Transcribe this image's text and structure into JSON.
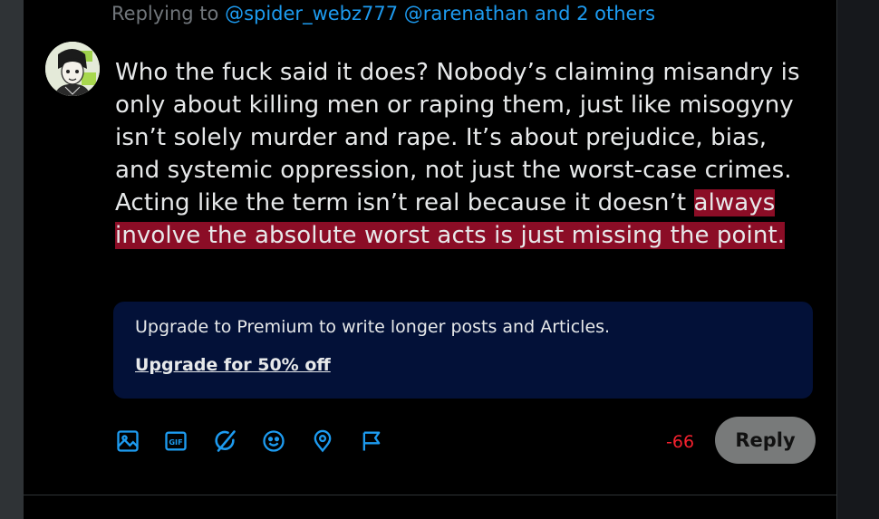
{
  "reply_context": {
    "prefix": "Replying to ",
    "handles": "@spider_webz777 @rarenathan and 2 others"
  },
  "compose": {
    "text_within_limit": "Who the fuck said it does? Nobody’s claiming misandry is only about killing men or raping them, just like misogyny isn’t solely murder and rape. It’s about prejudice, bias, and systemic oppression, not just the worst-case crimes. Acting like the term isn’t real because it doesn’t",
    "text_over_limit": "always involve the absolute worst acts is just missing the point."
  },
  "premium_prompt": {
    "message": "Upgrade to Premium to write longer posts and Articles.",
    "link_label": "Upgrade for 50% off"
  },
  "toolbar": {
    "icons": [
      "image-icon",
      "gif-icon",
      "grok-icon",
      "emoji-icon",
      "location-icon",
      "flag-icon"
    ]
  },
  "char_counter": "-66",
  "reply_button_label": "Reply",
  "colors": {
    "accent": "#1d9bf0",
    "over_limit_highlight": "#8b0d26",
    "counter_negative": "#f4212e",
    "premium_box": "#031138",
    "reply_button_disabled": "#787a7a"
  }
}
